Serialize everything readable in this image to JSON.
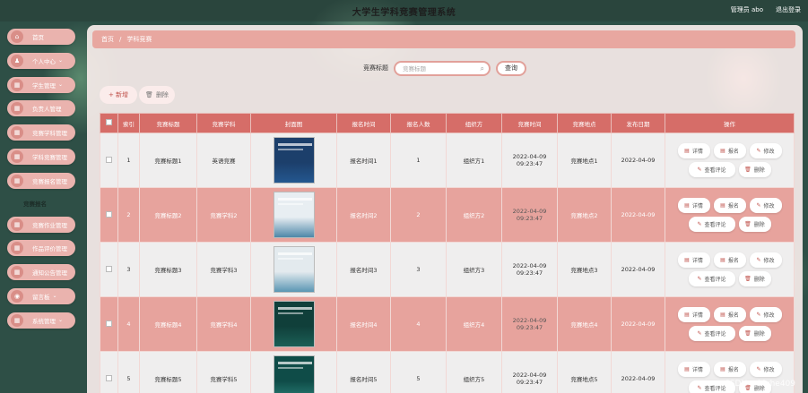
{
  "app": {
    "title": "大学生学科竞赛管理系统",
    "user": "管理员 abo",
    "logout": "退出登录"
  },
  "sidebar": {
    "items": [
      {
        "label": "首页",
        "icon": "home-icon",
        "glyph": "⌂",
        "chevron": ""
      },
      {
        "label": "个人中心",
        "icon": "user-icon",
        "glyph": "♟",
        "chevron": "⌄"
      },
      {
        "label": "学生管理",
        "icon": "grid-icon",
        "glyph": "▦",
        "chevron": "⌄"
      },
      {
        "label": "负责人管理",
        "icon": "grid-icon",
        "glyph": "▦",
        "chevron": ""
      },
      {
        "label": "竞赛学科管理",
        "icon": "grid-icon",
        "glyph": "▦",
        "chevron": ""
      },
      {
        "label": "学科竞赛管理",
        "icon": "grid-icon",
        "glyph": "▦",
        "chevron": ""
      },
      {
        "label": "竞赛报名管理",
        "icon": "grid-icon",
        "glyph": "▦",
        "chevron": ""
      },
      {
        "label": "竞赛报名",
        "icon": "",
        "glyph": "",
        "chevron": "",
        "plain": true
      },
      {
        "label": "竞赛作业管理",
        "icon": "grid-icon",
        "glyph": "▦",
        "chevron": ""
      },
      {
        "label": "作品评价管理",
        "icon": "grid-icon",
        "glyph": "▦",
        "chevron": ""
      },
      {
        "label": "通知公告管理",
        "icon": "grid-icon",
        "glyph": "▦",
        "chevron": ""
      },
      {
        "label": "留言板",
        "icon": "location-icon",
        "glyph": "◉",
        "chevron": "⌄"
      },
      {
        "label": "系统管理",
        "icon": "grid-icon",
        "glyph": "▦",
        "chevron": "⌄"
      }
    ]
  },
  "breadcrumb": {
    "home": "首页",
    "separator": "/",
    "current": "学科竞赛"
  },
  "search": {
    "label": "竞赛标题",
    "placeholder": "竞赛标题",
    "button": "查询"
  },
  "toolbar": {
    "add": "+ 新增",
    "delete": "删除"
  },
  "table": {
    "headers": [
      "索引",
      "竞赛标题",
      "竞赛学科",
      "封面图",
      "报名时间",
      "报名人数",
      "组织方",
      "竞赛时间",
      "竞赛地点",
      "发布日期",
      "操作"
    ],
    "rows": [
      {
        "index": "1",
        "title": "竞赛标题1",
        "subject": "英语竞赛",
        "signup": "报名时间1",
        "count": "1",
        "organizer": "组织方1",
        "time": "2022-04-09 09:23:47",
        "place": "竞赛地点1",
        "date": "2022-04-09"
      },
      {
        "index": "2",
        "title": "竞赛标题2",
        "subject": "竞赛学科2",
        "signup": "报名时间2",
        "count": "2",
        "organizer": "组织方2",
        "time": "2022-04-09 09:23:47",
        "place": "竞赛地点2",
        "date": "2022-04-09"
      },
      {
        "index": "3",
        "title": "竞赛标题3",
        "subject": "竞赛学科3",
        "signup": "报名时间3",
        "count": "3",
        "organizer": "组织方3",
        "time": "2022-04-09 09:23:47",
        "place": "竞赛地点3",
        "date": "2022-04-09"
      },
      {
        "index": "4",
        "title": "竞赛标题4",
        "subject": "竞赛学科4",
        "signup": "报名时间4",
        "count": "4",
        "organizer": "组织方4",
        "time": "2022-04-09 09:23:47",
        "place": "竞赛地点4",
        "date": "2022-04-09"
      },
      {
        "index": "5",
        "title": "竞赛标题5",
        "subject": "竞赛学科5",
        "signup": "报名时间5",
        "count": "5",
        "organizer": "组织方5",
        "time": "2022-04-09 09:23:47",
        "place": "竞赛地点5",
        "date": "2022-04-09"
      }
    ],
    "ops": {
      "detail": "详情",
      "signup": "报名",
      "edit": "修改",
      "review": "查看评论",
      "delete": "删除"
    }
  },
  "colors": {
    "accent": "#d66d68",
    "row_alt": "#e7a39d",
    "panel": "#f6ecea"
  },
  "watermark": "CSDN @biyhe409"
}
